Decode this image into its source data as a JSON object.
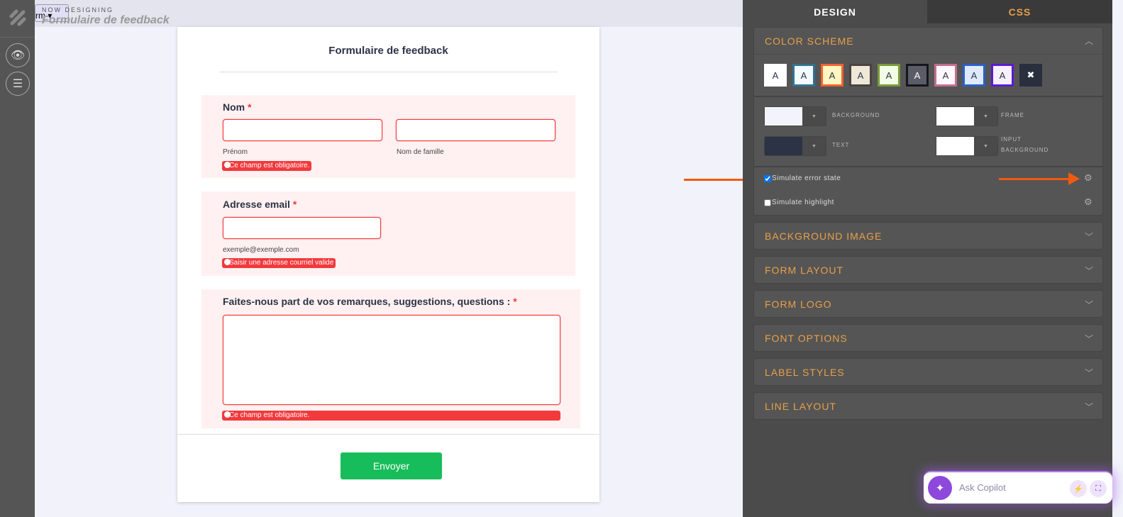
{
  "header": {
    "now_designing": "NOW DESIGNING",
    "form_title": "Formulaire de feedback",
    "form_select": "rm"
  },
  "form": {
    "title": "Formulaire de feedback",
    "name": {
      "label": "Nom",
      "required": "*",
      "first_sub": "Prénom",
      "last_sub": "Nom de famille",
      "error": "Ce champ est obligatoire."
    },
    "email": {
      "label": "Adresse email",
      "required": "*",
      "sub": "exemple@exemple.com",
      "error": "Saisir une adresse courriel valide"
    },
    "comments": {
      "label": "Faites-nous part de vos remarques, suggestions, questions :",
      "required": "*",
      "error": "Ce champ est obligatoire."
    },
    "submit": "Envoyer"
  },
  "panel": {
    "tabs": [
      "DESIGN",
      "CSS"
    ],
    "color_scheme": {
      "title": "COLOR SCHEME",
      "swatches": [
        {
          "label": "A",
          "bg": "#ffffff",
          "border": "#ffffff",
          "fg": "#2c3345"
        },
        {
          "label": "A",
          "bg": "#f3fbff",
          "border": "#2f7391",
          "fg": "#2c3345"
        },
        {
          "label": "A",
          "bg": "#fff6c2",
          "border": "#f2632f",
          "fg": "#2c3345"
        },
        {
          "label": "A",
          "bg": "#efe8d8",
          "border": "#4a4340",
          "fg": "#2c3345"
        },
        {
          "label": "A",
          "bg": "#f3fde6",
          "border": "#7a9a3a",
          "fg": "#2c3345"
        },
        {
          "label": "A",
          "bg": "#5a5d66",
          "border": "#16161e",
          "fg": "#ffffff"
        },
        {
          "label": "A",
          "bg": "#fff7fa",
          "border": "#c26e8f",
          "fg": "#2c3345"
        },
        {
          "label": "A",
          "bg": "#dfeaff",
          "border": "#2a5fc7",
          "fg": "#2c3345"
        },
        {
          "label": "A",
          "bg": "#f6f1ff",
          "border": "#5a1bd6",
          "fg": "#2c3345"
        }
      ],
      "reset": "✖",
      "colors": [
        {
          "label": "BACKGROUND",
          "value": "#f3f3fe"
        },
        {
          "label": "FRAME",
          "value": "#ffffff"
        },
        {
          "label": "TEXT",
          "value": "#2c3345"
        },
        {
          "label": "INPUT BACKGROUND",
          "value": "#ffffff"
        }
      ],
      "simulate_error": "Simulate error state",
      "simulate_highlight": "Simulate highlight"
    },
    "sections": [
      "BACKGROUND IMAGE",
      "FORM LAYOUT",
      "FORM LOGO",
      "FONT OPTIONS",
      "LABEL STYLES",
      "LINE LAYOUT"
    ]
  },
  "copilot": {
    "placeholder": "Ask Copilot"
  }
}
